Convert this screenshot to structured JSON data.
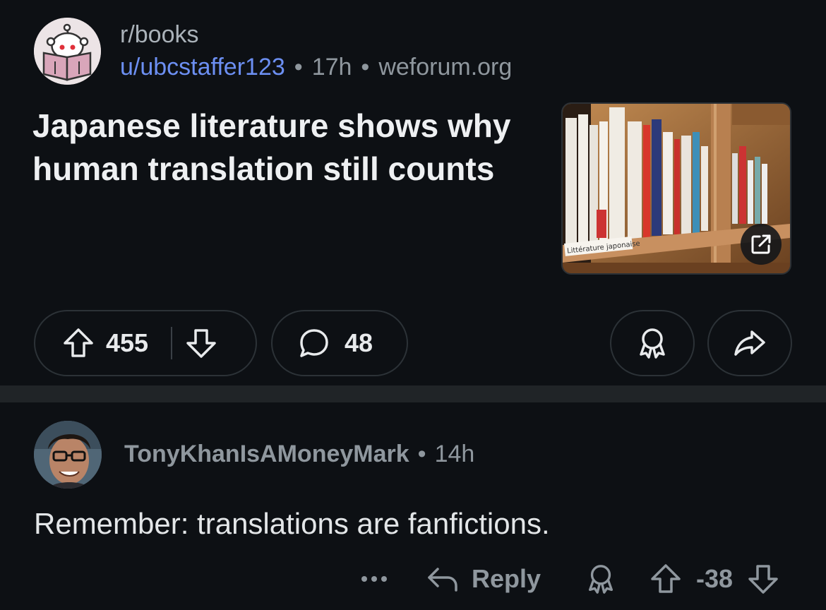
{
  "post": {
    "subreddit": "r/books",
    "author": "u/ubcstaffer123",
    "separator": "•",
    "age": "17h",
    "domain": "weforum.org",
    "title": "Japanese literature shows why human translation still counts",
    "thumbnail_caption": "Littérature japonaise",
    "upvotes": "455",
    "comments": "48"
  },
  "comment": {
    "author": "TonyKhanIsAMoneyMark",
    "separator": "•",
    "age": "14h",
    "body": "Remember: translations are fanfictions.",
    "reply_label": "Reply",
    "score": "-38"
  },
  "colors": {
    "background": "#0d1014",
    "username_link": "#6c8ff2",
    "muted_text": "#8f979e",
    "pill_border": "#2c3237"
  },
  "icons": [
    "subreddit-avatar",
    "external-link-icon",
    "upvote-icon",
    "downvote-icon",
    "comment-icon",
    "award-icon",
    "share-icon",
    "more-icon",
    "reply-icon"
  ]
}
